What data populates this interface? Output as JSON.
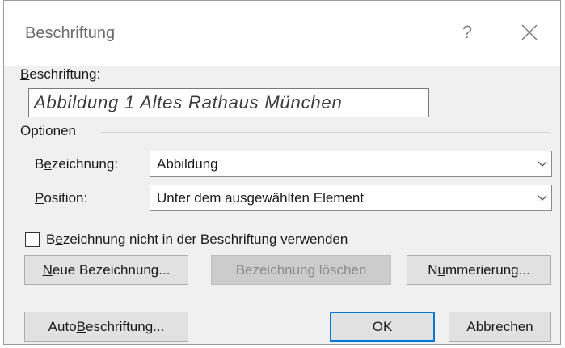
{
  "dialog": {
    "title": "Beschriftung",
    "help_glyph": "?"
  },
  "caption": {
    "label_first": "B",
    "label_rest": "eschriftung:",
    "value": "Abbildung 1 Altes Rathaus München"
  },
  "options": {
    "group_label": "Optionen",
    "label_field": {
      "label_pre": "B",
      "label_accel": "e",
      "label_post": "zeichnung:",
      "value": "Abbildung"
    },
    "position_field": {
      "label_accel": "P",
      "label_post": "osition:",
      "value": "Unter dem ausgewählten Element"
    }
  },
  "exclude_label": {
    "checked": false,
    "text_pre": "B",
    "text_accel": "e",
    "text_post": "zeichnung nicht in der Beschriftung verwenden"
  },
  "buttons": {
    "new_label_accel": "N",
    "new_label_rest": "eue Bezeichnung...",
    "delete_label": "Bezeichnung löschen",
    "numbering_pre": "N",
    "numbering_accel": "u",
    "numbering_post": "mmerierung...",
    "autocaption_pre": "Auto",
    "autocaption_accel": "B",
    "autocaption_post": "eschriftung...",
    "ok": "OK",
    "cancel": "Abbrechen"
  },
  "colors": {
    "dialog_bg": "#f0f0f0",
    "default_button_border": "#0078d7"
  },
  "icons": [
    "help-icon",
    "close-icon",
    "chevron-down-icon"
  ]
}
